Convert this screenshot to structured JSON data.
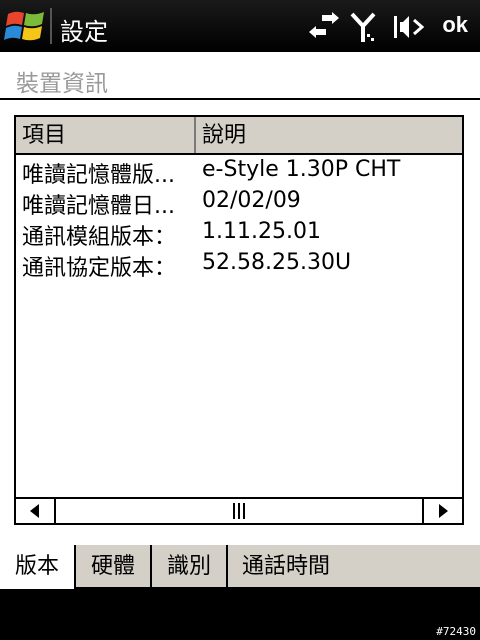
{
  "titlebar": {
    "title": "設定",
    "ok_label": "ok"
  },
  "page": {
    "heading": "裝置資訊"
  },
  "list": {
    "columns": [
      "項目",
      "說明"
    ],
    "rows": [
      {
        "item": "唯讀記憶體版...",
        "desc": "e-Style 1.30P CHT"
      },
      {
        "item": "唯讀記憶體日...",
        "desc": "02/02/09"
      },
      {
        "item": "通訊模組版本：",
        "desc": "1.11.25.01"
      },
      {
        "item": "通訊協定版本：",
        "desc": "52.58.25.30U"
      }
    ]
  },
  "tabs": [
    {
      "label": "版本",
      "active": true
    },
    {
      "label": "硬體",
      "active": false
    },
    {
      "label": "識別",
      "active": false
    },
    {
      "label": "通話時間",
      "active": false
    }
  ],
  "footer": {
    "build": "#72430"
  }
}
